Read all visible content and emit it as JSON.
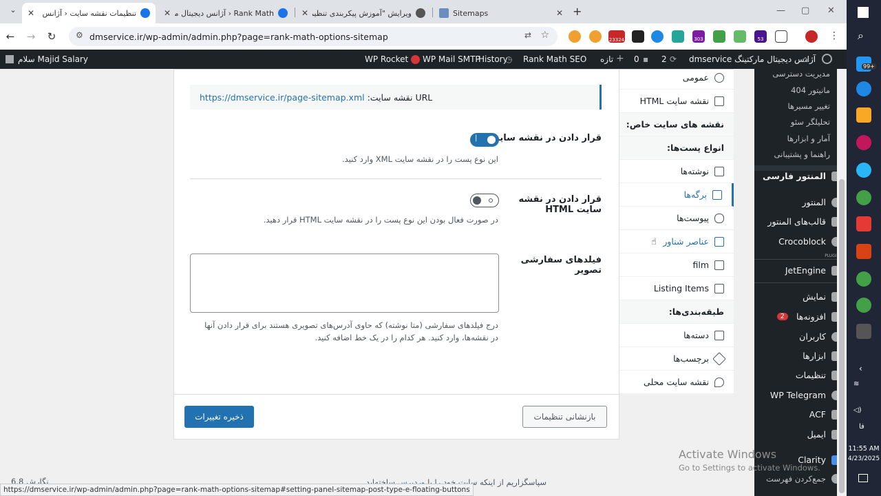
{
  "browser": {
    "tabs": [
      {
        "title": "تنظیمات نقشه سایت ‹ آژانس دیجیتال",
        "active": true
      },
      {
        "title": "Rank Math ‹ آژانس دیجیتال مارکتینگ تنظیما"
      },
      {
        "title": "ویرایش \"آموزش پیکربندی تنظیما"
      },
      {
        "title": "Sitemaps"
      }
    ],
    "url": "dmservice.ir/wp-admin/admin.php?page=rank-math-options-sitemap",
    "ext_counts": [
      "23324",
      "303",
      "53"
    ]
  },
  "adminbar": {
    "greeting": "سلام Majid Salary",
    "site_name": "آژانس دیجیتال مارکتینگ dmservice",
    "updates": "2",
    "comments": "0",
    "new_label": "تازه",
    "rankmath": "Rank Math SEO",
    "history": "History",
    "smtp": "WP Mail SMTP",
    "rocket": "WP Rocket"
  },
  "sidebar": {
    "subitems": [
      "مدیریت دسترسی",
      "مانیتور 404",
      "تغییر مسیرها",
      "تحلیلگر سئو",
      "آمار و ابزارها",
      "راهنما و پشتیبانی"
    ],
    "items": [
      {
        "label": "المنتور فارسی"
      },
      {
        "label": "المنتور"
      },
      {
        "label": "قالب‌های المنتور"
      },
      {
        "label": "Crocoblock"
      },
      {
        "label": "JetEngine"
      },
      {
        "label": "نمایش"
      },
      {
        "label": "افزونه‌ها",
        "badge": "2"
      },
      {
        "label": "کاربران"
      },
      {
        "label": "ابزارها"
      },
      {
        "label": "تنظیمات"
      },
      {
        "label": "WP Telegram"
      },
      {
        "label": "ACF"
      },
      {
        "label": "ایمیل"
      },
      {
        "label": "Clarity"
      },
      {
        "label": "جمع‌کردن فهرست"
      }
    ],
    "plugins_tag": "PLUGINS"
  },
  "tabs_col": [
    {
      "label": "عمومی"
    },
    {
      "label": "نقشه سایت HTML"
    },
    {
      "label": "نقشه های سایت خاص:",
      "head": true
    },
    {
      "label": "انواع پست‌ها:",
      "head": true
    },
    {
      "label": "نوشته‌ها"
    },
    {
      "label": "برگه‌ها",
      "active": true
    },
    {
      "label": "پیوست‌ها"
    },
    {
      "label": "عناصر شناور"
    },
    {
      "label": "film"
    },
    {
      "label": "Listing Items"
    },
    {
      "label": "طبقه‌بندی‌ها:",
      "head": true
    },
    {
      "label": "دسته‌ها"
    },
    {
      "label": "برچسب‌ها"
    },
    {
      "label": "نقشه سایت محلی"
    }
  ],
  "main": {
    "url_label": "URL نقشه سایت:",
    "url_value": "https://dmservice.ir/page-sitemap.xml",
    "include_label": "قرار دادن در نقشه سایت",
    "include_desc": "این نوع پست را در نقشه سایت XML وارد کنید.",
    "include_on": true,
    "html_label": "قرار دادن در نقشه سایت HTML",
    "html_desc": "در صورت فعال بودن این نوع پست را در نقشه سایت HTML قرار دهید.",
    "html_on": false,
    "custom_label": "فیلدهای سفارشی تصویر",
    "custom_desc_1": "درج فیلدهای سفارشی (متا نوشته) که حاوی آدرس‌های تصویری هستند برای قرار دادن آنها",
    "custom_desc_2": "در نقشه‌ها، وارد کنید. هر کدام را در یک خط اضافه کنید.",
    "reset_label": "بازنشانی تنظیمات",
    "save_label": "ذخیره تغییرات"
  },
  "footer": {
    "thanks": "سپاسگزاریم از اینکه سایت خود را با",
    "wp_link": "وردپرس",
    "suffix": "ساخته‌اید.",
    "version": "نگارش 6.8"
  },
  "status_url": "https://dmservice.ir/wp-admin/admin.php?page=rank-math-options-sitemap#setting-panel-sitemap-post-type-e-floating-buttons",
  "watermark": {
    "title": "Activate Windows",
    "sub": "Go to Settings to activate Windows."
  },
  "clock": {
    "time": "11:55 AM",
    "date": "4/23/2025",
    "lang": "فا",
    "notif": "99+"
  }
}
